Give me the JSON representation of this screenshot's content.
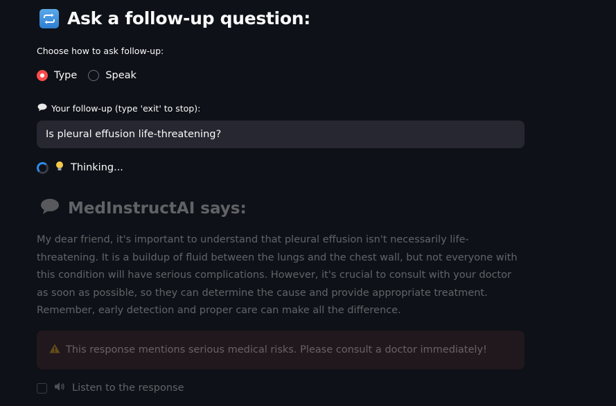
{
  "section": {
    "title": "Ask a follow-up question:",
    "icon": "repeat-icon"
  },
  "mode": {
    "label": "Choose how to ask follow-up:",
    "options": [
      "Type",
      "Speak"
    ],
    "selected": "Type"
  },
  "followup": {
    "label": "Your follow-up (type 'exit' to stop):",
    "value": "Is pleural effusion life-threatening?"
  },
  "status": {
    "text": "Thinking..."
  },
  "response": {
    "heading": "MedInstructAI says:",
    "body": "My dear friend, it's important to understand that pleural effusion isn't necessarily life-threatening. It is a buildup of fluid between the lungs and the chest wall, but not everyone with this condition will have serious complications. However, it's crucial to consult with your doctor as soon as possible, so they can determine the cause and provide appropriate treatment. Remember, early detection and proper care can make all the difference."
  },
  "alert": {
    "text": "This response mentions serious medical risks. Please consult a doctor immediately!"
  },
  "listen": {
    "label": "Listen to the response",
    "checked": false
  },
  "colors": {
    "background": "#0e1117",
    "accent": "#ff4b4b",
    "input_bg": "#262730",
    "spinner": "#2e8cf0"
  }
}
